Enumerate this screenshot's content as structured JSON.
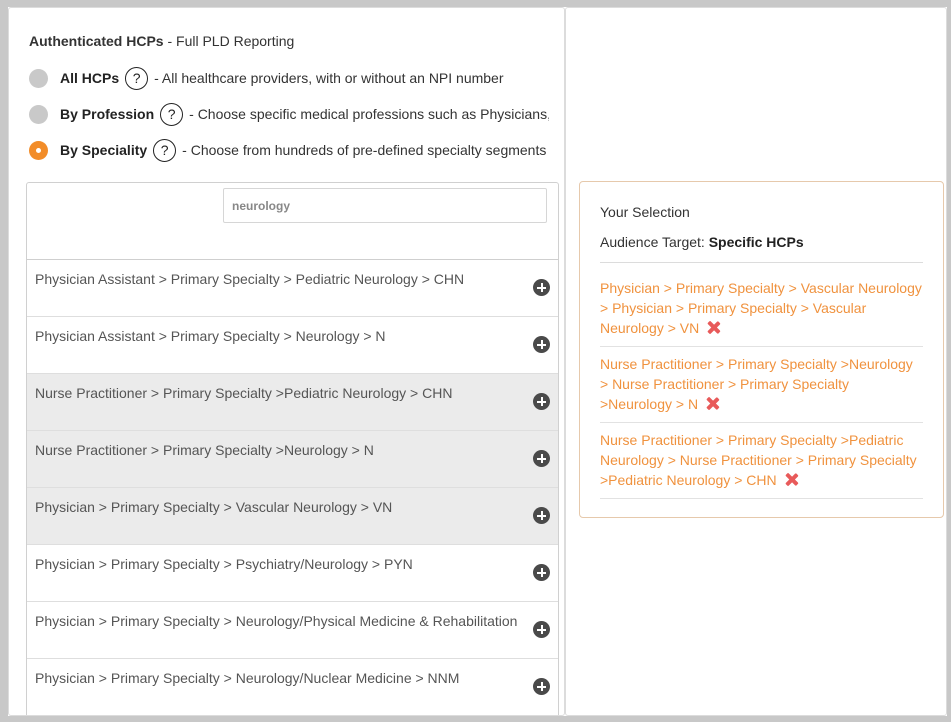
{
  "section": {
    "title_bold": "Authenticated HCPs",
    "title_rest": " - Full PLD Reporting"
  },
  "options": [
    {
      "label": "All HCPs",
      "help": "?",
      "desc": "- All healthcare providers, with or without an NPI number",
      "selected": false
    },
    {
      "label": "By Profession",
      "help": "?",
      "desc": "- Choose specific medical professions such as Physicians, Nurse Practitioners",
      "selected": false
    },
    {
      "label": "By Speciality",
      "help": "?",
      "desc": "- Choose from hundreds of pre-defined specialty segments",
      "selected": true
    }
  ],
  "search": {
    "value": "neurology"
  },
  "results": [
    {
      "text": "Physician Assistant > Primary Specialty > Pediatric Neurology > CHN",
      "shaded": false
    },
    {
      "text": "Physician Assistant > Primary Specialty > Neurology > N",
      "shaded": false
    },
    {
      "text": "Nurse Practitioner > Primary Specialty >Pediatric Neurology > CHN",
      "shaded": true
    },
    {
      "text": "Nurse Practitioner > Primary Specialty >Neurology > N",
      "shaded": true
    },
    {
      "text": "Physician > Primary Specialty > Vascular Neurology > VN",
      "shaded": true
    },
    {
      "text": "Physician > Primary Specialty > Psychiatry/Neurology > PYN",
      "shaded": false
    },
    {
      "text": "Physician > Primary Specialty > Neurology/Physical Medicine & Rehabilitation > NPR",
      "shaded": false
    },
    {
      "text": "Physician > Primary Specialty > Neurology/Nuclear Medicine > NNM",
      "shaded": false
    }
  ],
  "selection": {
    "title": "Your Selection",
    "target_label": "Audience Target:",
    "target_value": "Specific HCPs",
    "items": [
      "Physician > Primary Specialty > Vascular Neurology > Physician > Primary Specialty > Vascular Neurology > VN",
      "Nurse Practitioner > Primary Specialty >Neurology > Nurse Practitioner > Primary Specialty >Neurology > N",
      "Nurse Practitioner > Primary Specialty >Pediatric Neurology > Nurse Practitioner > Primary Specialty >Pediatric Neurology > CHN"
    ]
  },
  "colors": {
    "accent": "#f28c28",
    "selection_text": "#f0923e",
    "remove": "#e85a5a",
    "radio_off": "#c9c9c9"
  },
  "icons": {
    "help": "question-circle-icon",
    "add": "plus-circle-icon",
    "remove": "x-icon"
  }
}
